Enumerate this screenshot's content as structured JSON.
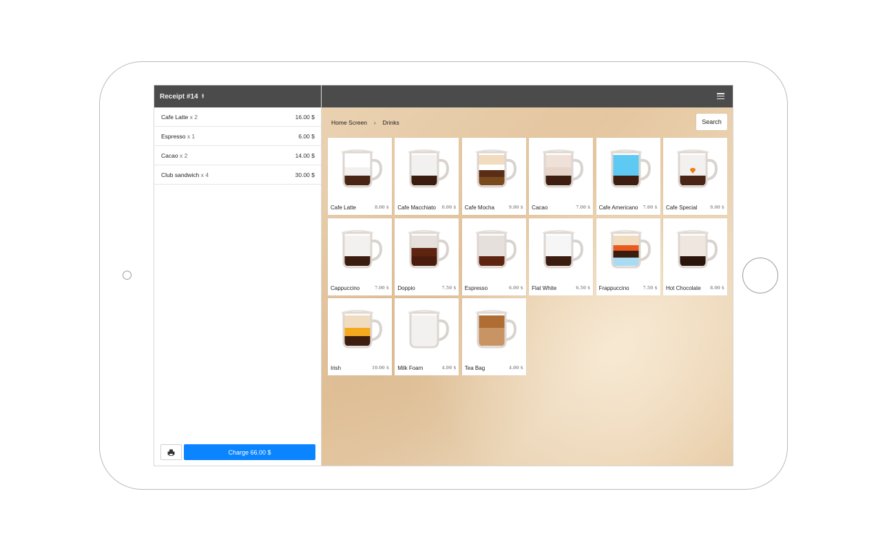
{
  "receipt": {
    "title": "Receipt #14",
    "items": [
      {
        "name": "Cafe Latte",
        "qty": "x 2",
        "price": "16.00 $"
      },
      {
        "name": "Espresso",
        "qty": "x 1",
        "price": "6.00 $"
      },
      {
        "name": "Cacao",
        "qty": "x 2",
        "price": "14.00 $"
      },
      {
        "name": "Club sandwich",
        "qty": "x 4",
        "price": "30.00 $"
      }
    ],
    "charge_label": "Charge 66.00 $"
  },
  "breadcrumb": {
    "home": "Home Screen",
    "separator": "›",
    "current": "Drinks"
  },
  "search_label": "Search",
  "products": [
    {
      "name": "Cafe Latte",
      "price": "8.00 $",
      "layers": [
        "#ffffff",
        "#f3f1ef",
        "#4a2414"
      ]
    },
    {
      "name": "Cafe Macchiato",
      "price": "0.00 $",
      "layers": [
        "#f3f1ef",
        "#f3f1ef",
        "#3b1d10"
      ]
    },
    {
      "name": "Cafe Mocha",
      "price": "9.00 $",
      "layers": [
        "#f1dcbf",
        "#ffffff",
        "#5a2e16",
        "#7a4a1c"
      ]
    },
    {
      "name": "Cacao",
      "price": "7.00 $",
      "layers": [
        "#efe0d8",
        "#e7d4cb",
        "#3e1e10"
      ]
    },
    {
      "name": "Cafe Americano",
      "price": "7.00 $",
      "layers": [
        "#5ec9f2",
        "#5ec9f2",
        "#3e1e10"
      ]
    },
    {
      "name": "Cafe Special",
      "price": "9.00 $",
      "layers": [
        "#f3f1ef",
        "#f3f1ef",
        "#4a2414"
      ],
      "accent": "#ef7c17"
    },
    {
      "name": "Cappuccino",
      "price": "7.00 $",
      "layers": [
        "#f3f1ef",
        "#f3f1ef",
        "#3b1d10"
      ]
    },
    {
      "name": "Doppio",
      "price": "7.50 $",
      "layers": [
        "#e6e0dc",
        "#5e2412",
        "#4a1c0e"
      ]
    },
    {
      "name": "Espresso",
      "price": "6.00 $",
      "layers": [
        "#e6e0dc",
        "#e6e0dc",
        "#5e2412"
      ]
    },
    {
      "name": "Flat White",
      "price": "6.50 $",
      "layers": [
        "#f6f6f6",
        "#f6f6f6",
        "#3b1d10"
      ]
    },
    {
      "name": "Frappuccino",
      "price": "7.50 $",
      "layers": [
        "#f1dcbf",
        "#ea5a1e",
        "#3b1d10",
        "#a9dcf3"
      ]
    },
    {
      "name": "Hot Chocolate",
      "price": "8.00 $",
      "layers": [
        "#efe6e0",
        "#efe6e0",
        "#2a140b"
      ]
    },
    {
      "name": "Irish",
      "price": "10.00 $",
      "layers": [
        "#f1dcbf",
        "#f5a91f",
        "#3e1e10"
      ]
    },
    {
      "name": "Milk Foam",
      "price": "4.00 $",
      "layers": [
        "#f3f1ef",
        "#f3f1ef",
        "#f3f1ef"
      ]
    },
    {
      "name": "Tea Bag",
      "price": "4.00 $",
      "layers": [
        "#b06d33",
        "#c99463",
        "#c99463"
      ]
    }
  ],
  "colors": {
    "accent": "#0a84ff",
    "header": "#4b4b4b"
  }
}
